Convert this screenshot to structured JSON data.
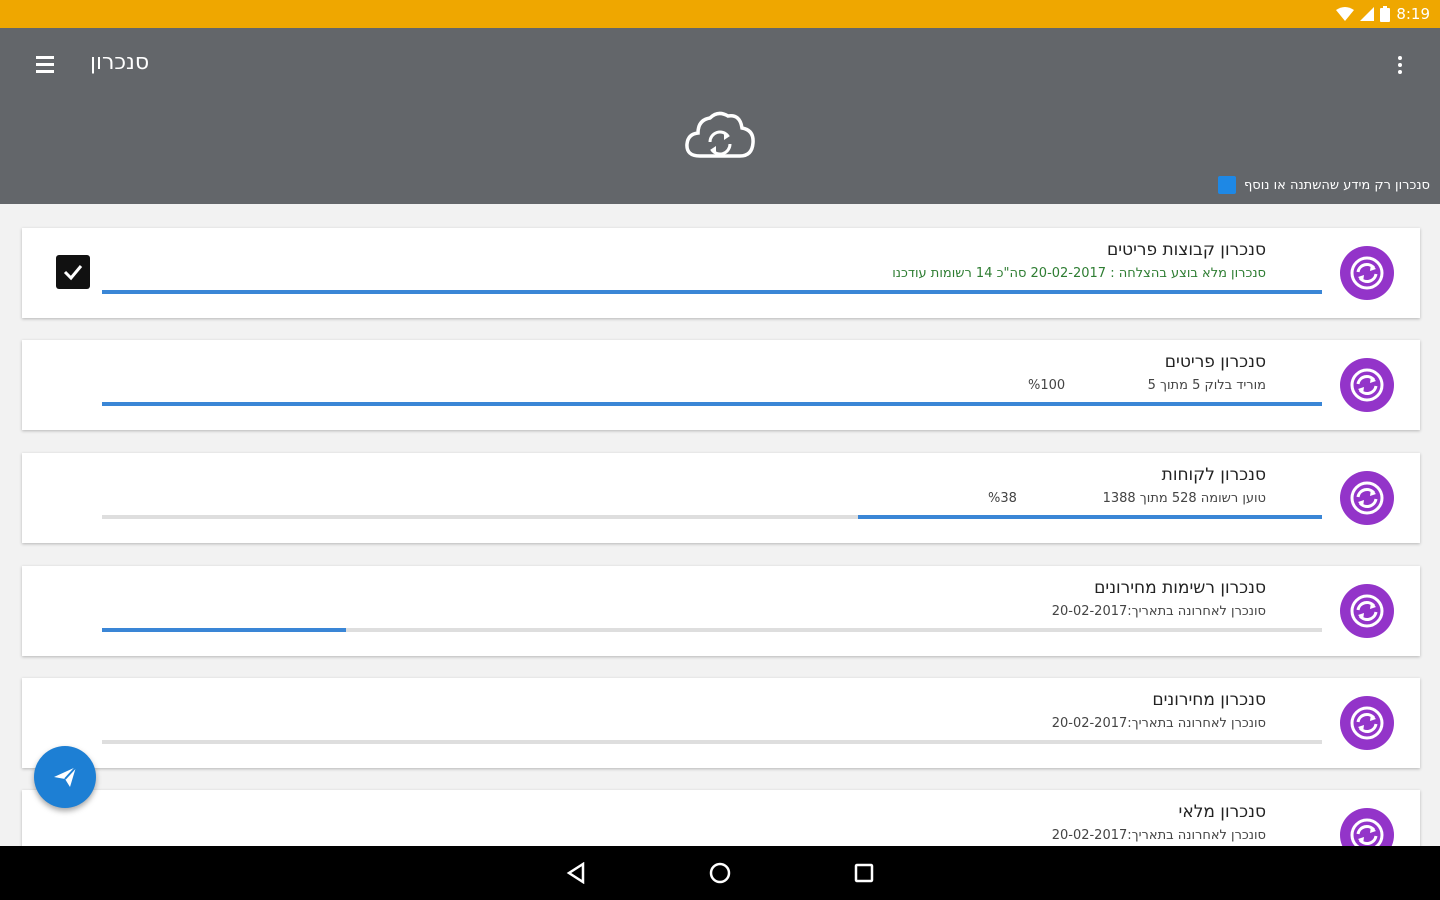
{
  "status_bar": {
    "time": "8:19"
  },
  "app_bar": {
    "title": "סנכרון",
    "changed_only_label": "סנכרון רק מידע שהשתנה או נוסף"
  },
  "sync_items": [
    {
      "title": "סנכרון קבוצות פריטים",
      "subtitle": "סנכרון מלא בוצע בהצלחה : 20-02-2017 סה\"כ 14 רשומות עודכנו",
      "percent": "",
      "progress": 1.0,
      "completed": true
    },
    {
      "title": "סנכרון פריטים",
      "subtitle": "מוריד בלוק 5 מתוך 5",
      "percent": "%100",
      "progress": 1.0,
      "completed": false
    },
    {
      "title": "סנכרון לקוחות",
      "subtitle": "טוען רשומה 528 מתוך 1388",
      "percent": "%38",
      "progress": 0.38,
      "completed": false
    },
    {
      "title": "סנכרון רשימות מחירונים",
      "subtitle": "סונכרן לאחרונה בתאריך:20-02-2017",
      "percent": "",
      "progress": 0.2,
      "completed": false
    },
    {
      "title": "סנכרון מחירונים",
      "subtitle": "סונכרן לאחרונה בתאריך:20-02-2017",
      "percent": "",
      "progress": 0.0,
      "completed": false
    },
    {
      "title": "סנכרון מלאי",
      "subtitle": "סונכרן לאחרונה בתאריך:20-02-2017",
      "percent": "",
      "progress": 0.0,
      "completed": false
    }
  ],
  "colors": {
    "status_bar": "#efa700",
    "app_bar": "#63666a",
    "sync_button": "#9334c9",
    "progress": "#3a86d6",
    "fab": "#1d7fd4"
  },
  "icons": {
    "menu": "hamburger-icon",
    "overflow": "more-vert-icon",
    "header": "cloud-sync-icon",
    "sync": "sync-icon",
    "fab": "send-icon",
    "nav_back": "back-triangle-icon",
    "nav_home": "home-circle-icon",
    "nav_recent": "recent-square-icon"
  }
}
